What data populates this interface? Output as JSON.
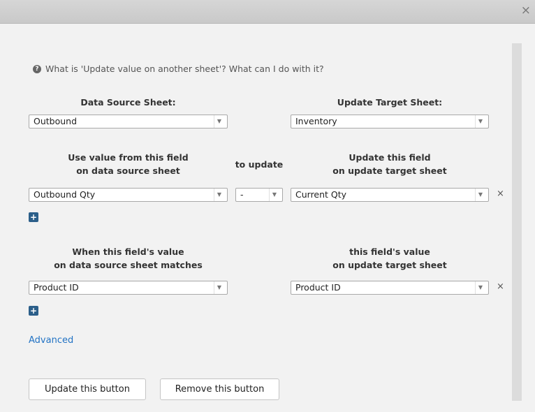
{
  "window": {
    "close_glyph": "×"
  },
  "help": {
    "icon": "question-circle-icon",
    "icon_glyph": "?",
    "text": "What is 'Update value on another sheet'? What can I do with it?"
  },
  "source_sheet": {
    "label": "Data Source Sheet:",
    "value": "Outbound"
  },
  "target_sheet": {
    "label": "Update Target Sheet:",
    "value": "Inventory"
  },
  "mapping": {
    "source_label_line1": "Use value from this field",
    "source_label_line2": "on data source sheet",
    "operator_label": "to update",
    "target_label_line1": "Update this field",
    "target_label_line2": "on update target sheet",
    "source_value": "Outbound Qty",
    "operator_value": "-",
    "target_value": "Current Qty",
    "remove_glyph": "×",
    "add_glyph": "+"
  },
  "match": {
    "source_label_line1": "When this field's value",
    "source_label_line2": "on data source sheet matches",
    "target_label_line1": "this field's value",
    "target_label_line2": "on update target sheet",
    "source_value": "Product ID",
    "target_value": "Product ID",
    "remove_glyph": "×",
    "add_glyph": "+"
  },
  "advanced_link": "Advanced",
  "buttons": {
    "update": "Update this button",
    "remove": "Remove this button"
  },
  "dropdown_arrow": "▼"
}
